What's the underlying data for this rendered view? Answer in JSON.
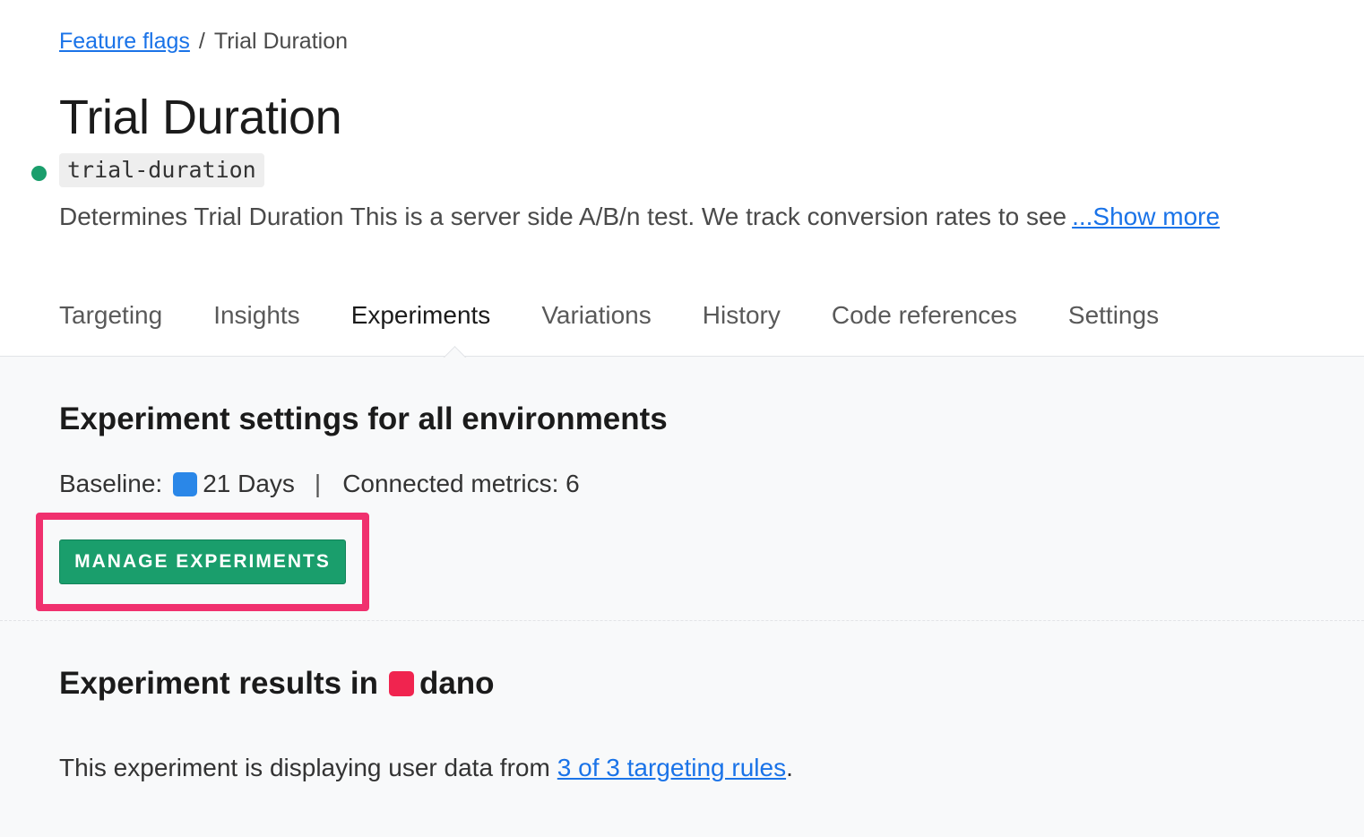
{
  "breadcrumb": {
    "parent": "Feature flags",
    "separator": "/",
    "current": "Trial Duration"
  },
  "flag": {
    "title": "Trial Duration",
    "key": "trial-duration",
    "status_color": "#1a9e6c",
    "description": "Determines Trial Duration This is a server side A/B/n test. We track conversion rates to see",
    "show_more": "...Show more"
  },
  "tabs": [
    {
      "label": "Targeting",
      "active": false
    },
    {
      "label": "Insights",
      "active": false
    },
    {
      "label": "Experiments",
      "active": true
    },
    {
      "label": "Variations",
      "active": false
    },
    {
      "label": "History",
      "active": false
    },
    {
      "label": "Code references",
      "active": false
    },
    {
      "label": "Settings",
      "active": false
    }
  ],
  "experiment_settings": {
    "title": "Experiment settings for all environments",
    "baseline_label": "Baseline:",
    "baseline_value": "21 Days",
    "baseline_color": "#2a87e8",
    "separator": "|",
    "connected_metrics_label": "Connected metrics: 6",
    "manage_button": "MANAGE EXPERIMENTS",
    "highlight_color": "#f0306e"
  },
  "experiment_results": {
    "title_prefix": "Experiment results in",
    "environment": "dano",
    "environment_color": "#f0244f",
    "text": "This experiment is displaying user data from",
    "link": "3 of 3 targeting rules",
    "suffix": "."
  }
}
